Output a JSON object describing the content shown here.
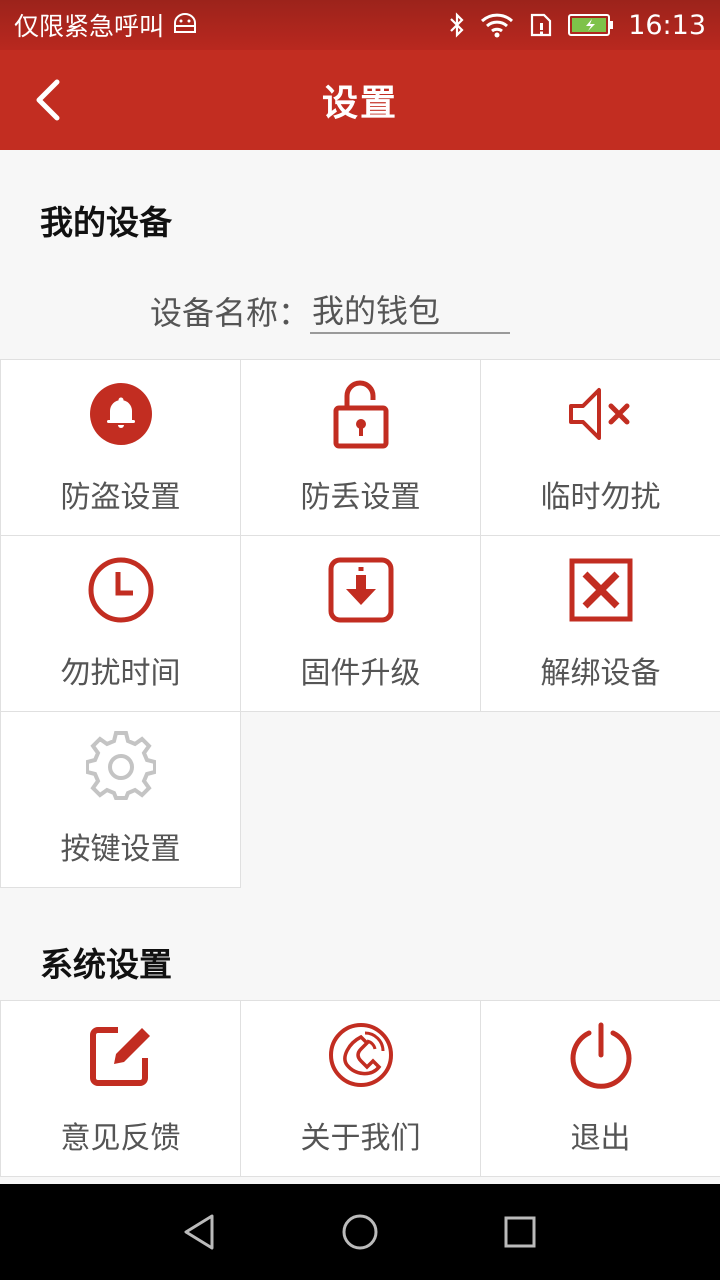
{
  "status_bar": {
    "carrier_text": "仅限紧急呼叫",
    "time": "16:13"
  },
  "header": {
    "title": "设置"
  },
  "my_devices": {
    "section_title": "我的设备",
    "device_name_label": "设备名称：",
    "device_name_value": "我的钱包",
    "items": [
      {
        "label": "防盗设置",
        "icon": "bell-icon"
      },
      {
        "label": "防丢设置",
        "icon": "unlock-icon"
      },
      {
        "label": "临时勿扰",
        "icon": "mute-icon"
      },
      {
        "label": "勿扰时间",
        "icon": "clock-icon"
      },
      {
        "label": "固件升级",
        "icon": "download-icon"
      },
      {
        "label": "解绑设备",
        "icon": "close-box-icon"
      },
      {
        "label": "按键设置",
        "icon": "gear-icon"
      }
    ]
  },
  "system_settings": {
    "section_title": "系统设置",
    "items": [
      {
        "label": "意见反馈",
        "icon": "edit-icon"
      },
      {
        "label": "关于我们",
        "icon": "phone-icon"
      },
      {
        "label": "退出",
        "icon": "power-icon"
      }
    ]
  },
  "colors": {
    "primary": "#c22d21",
    "icon_gray": "#c4c4c4",
    "text_gray": "#555555"
  }
}
